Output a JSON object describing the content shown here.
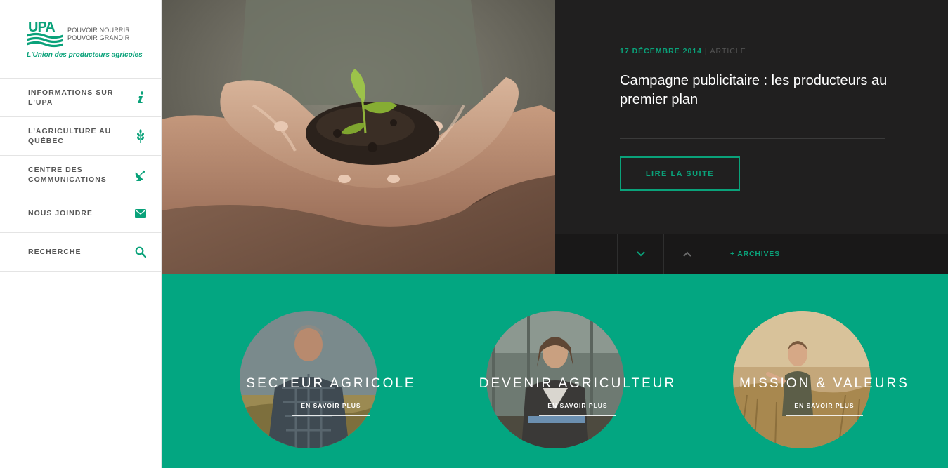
{
  "logo": {
    "brand": "UPA",
    "tagline_1": "POUVOIR NOURRIR",
    "tagline_2": "POUVOIR GRANDIR",
    "subtitle": "L'Union des producteurs agricoles"
  },
  "nav": {
    "items": [
      {
        "label": "INFORMATIONS SUR L'UPA",
        "icon": "info-icon"
      },
      {
        "label": "L'AGRICULTURE AU QUÉBEC",
        "icon": "wheat-icon"
      },
      {
        "label": "CENTRE DES COMMUNICATIONS",
        "icon": "satellite-dish-icon"
      },
      {
        "label": "NOUS JOINDRE",
        "icon": "envelope-icon"
      },
      {
        "label": "RECHERCHE",
        "icon": "search-icon"
      }
    ]
  },
  "article": {
    "date": "17 DÉCEMBRE 2014",
    "separator": "|",
    "type": "ARTICLE",
    "title": "Campagne publicitaire : les producteurs au premier plan",
    "read_more": "LIRE LA SUITE"
  },
  "pager": {
    "archives": "+ ARCHIVES"
  },
  "cards": [
    {
      "title": "SECTEUR AGRICOLE",
      "more": "EN SAVOIR PLUS"
    },
    {
      "title": "DEVENIR AGRICULTEUR",
      "more": "EN SAVOIR PLUS"
    },
    {
      "title": "MISSION & VALEURS",
      "more": "EN SAVOIR PLUS"
    }
  ],
  "colors": {
    "accent": "#03a681",
    "dark": "#201f1f",
    "brand_green": "#0aa27a"
  }
}
